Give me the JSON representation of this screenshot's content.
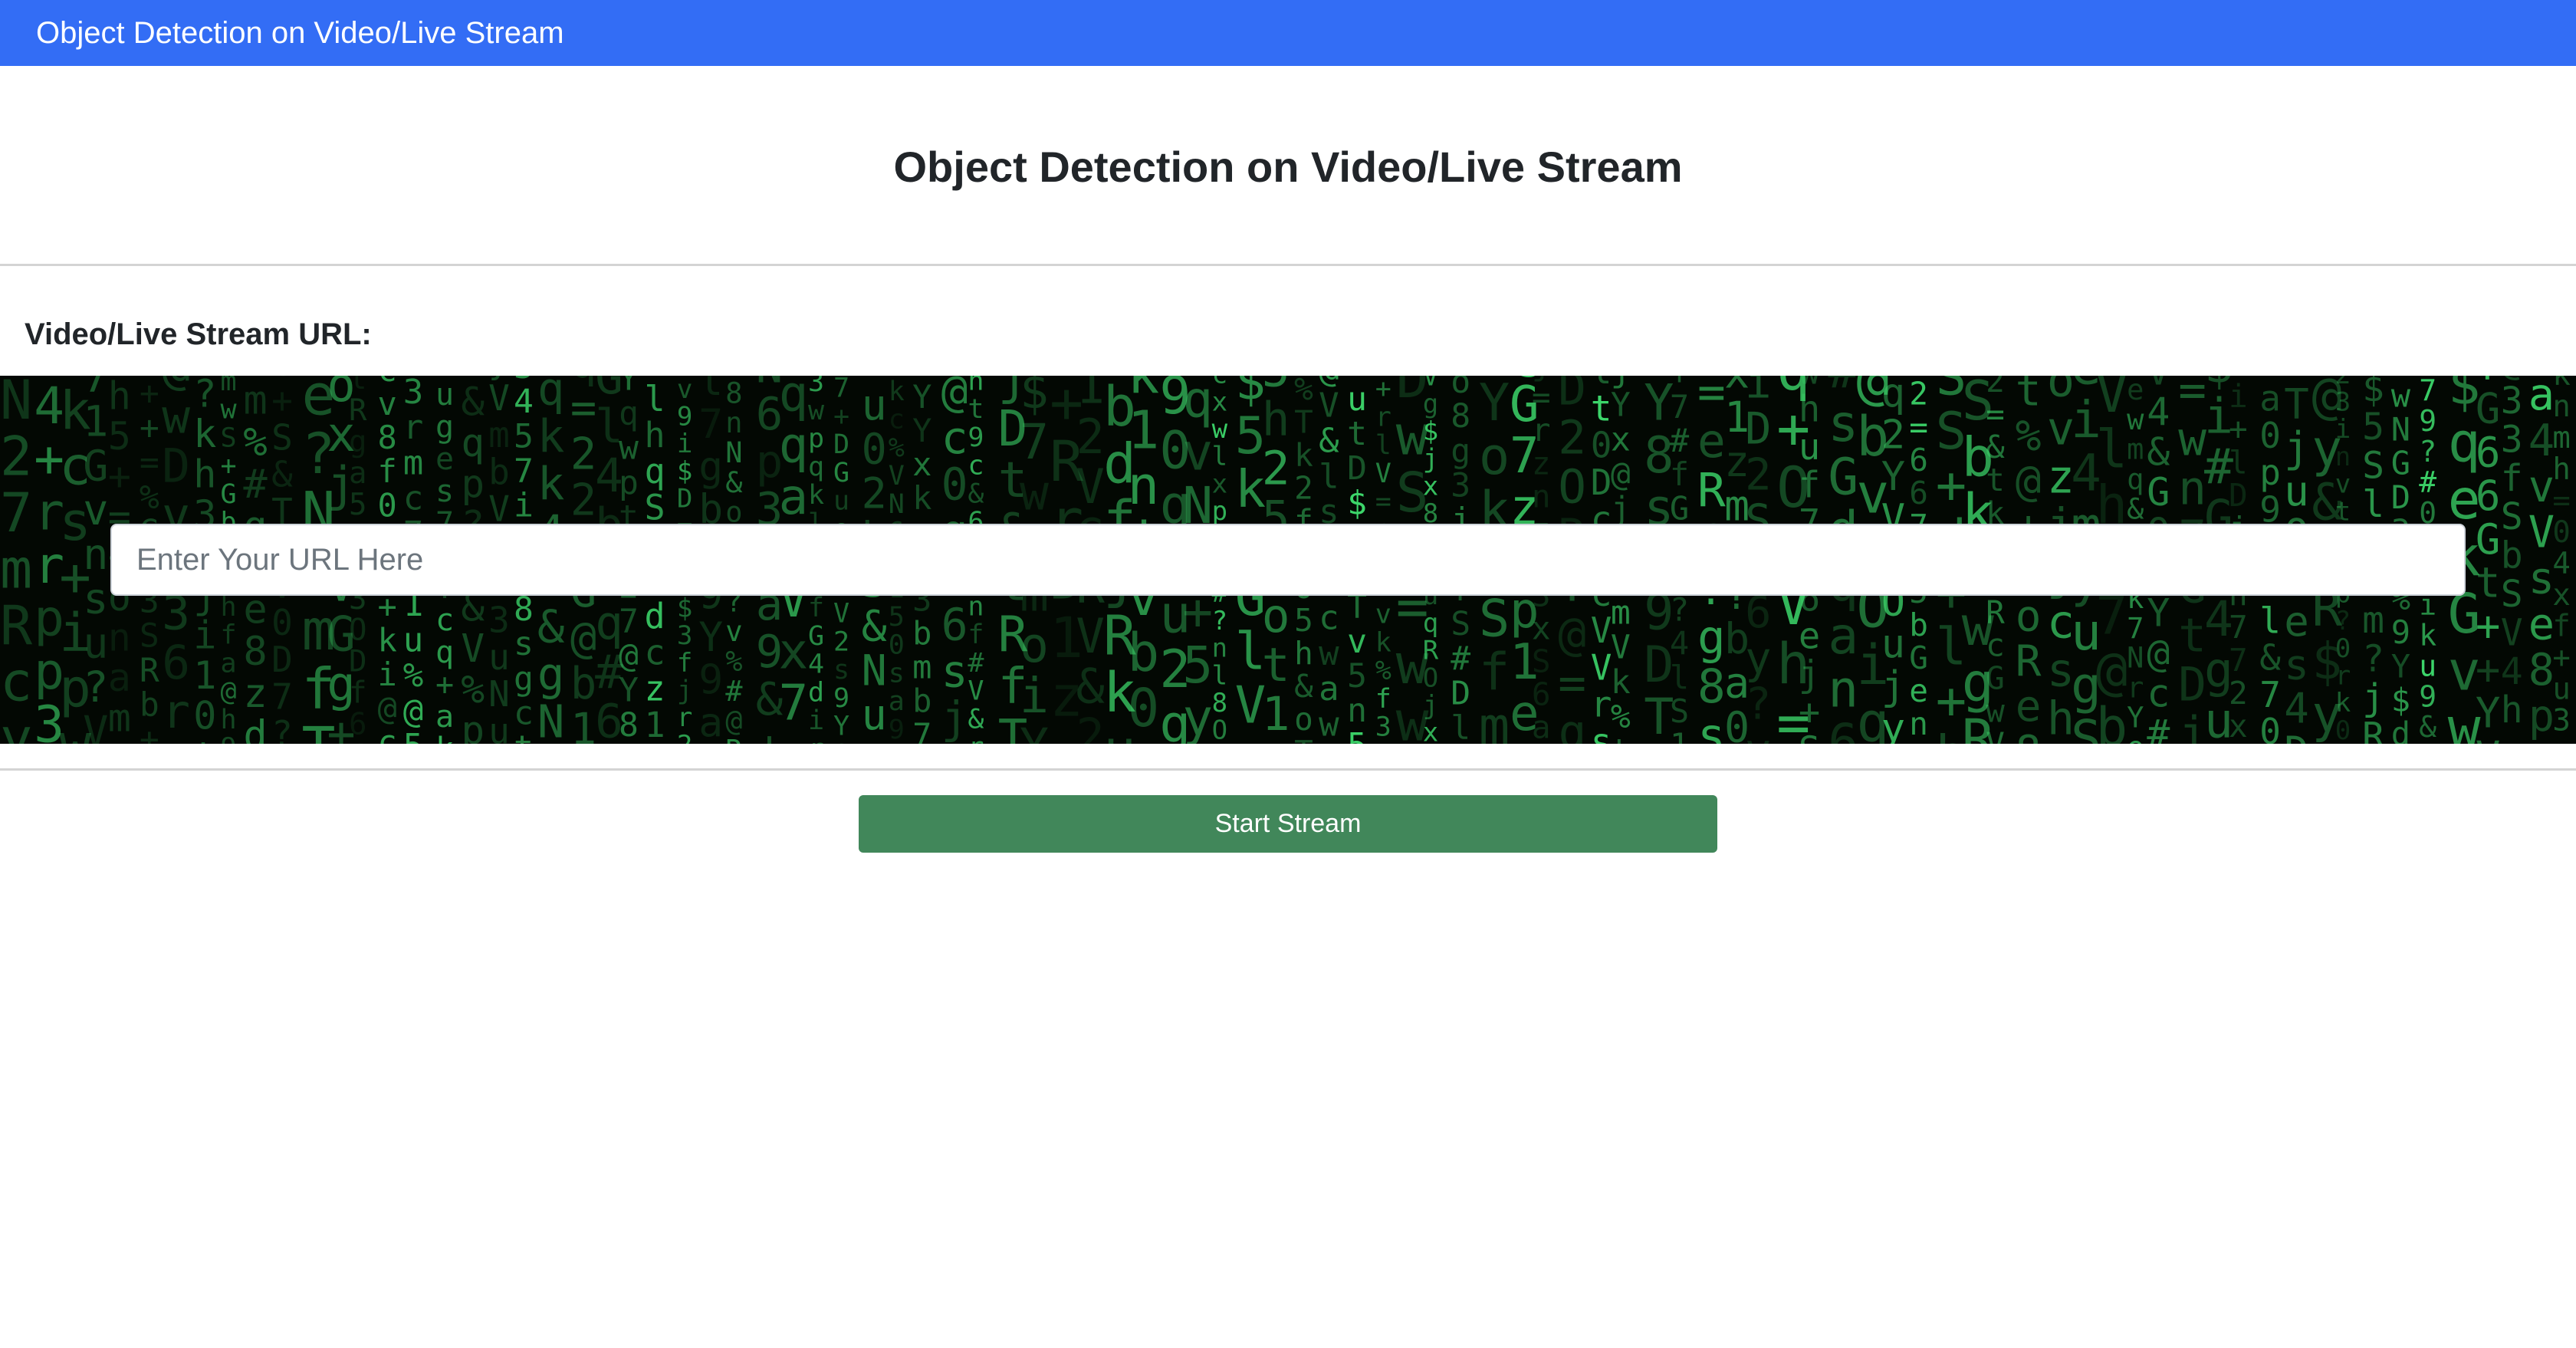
{
  "navbar": {
    "brand": "Object Detection on Video/Live Stream"
  },
  "main": {
    "title": "Object Detection on Video/Live Stream",
    "url_label": "Video/Live Stream URL:",
    "url_input": {
      "value": "",
      "placeholder": "Enter Your URL Here"
    },
    "start_button_label": "Start Stream"
  },
  "colors": {
    "navbar": "#336df5",
    "button": "#41875a",
    "matrix_green": "#3cd56a"
  }
}
